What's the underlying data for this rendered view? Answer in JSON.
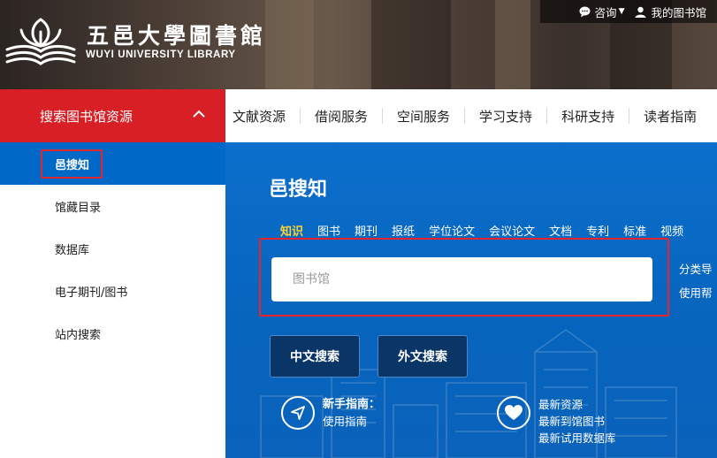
{
  "header": {
    "logo_cn": "五邑大學圖書館",
    "logo_en": "WUYI UNIVERSITY LIBRARY",
    "top_links": [
      {
        "label": "咨询",
        "icon": "chat-icon"
      },
      {
        "label": "我的图书馆",
        "icon": "user-icon"
      }
    ]
  },
  "nav": {
    "resource_label": "搜索图书馆资源",
    "items": [
      "文献资源",
      "借阅服务",
      "空间服务",
      "学习支持",
      "科研支持",
      "读者指南"
    ]
  },
  "side_menu": {
    "items": [
      "邑搜知",
      "馆藏目录",
      "数据库",
      "电子期刊/图书",
      "站内搜索"
    ],
    "active_index": 0
  },
  "search": {
    "title": "邑搜知",
    "tabs": [
      "知识",
      "图书",
      "期刊",
      "报纸",
      "学位论文",
      "会议论文",
      "文档",
      "专利",
      "标准",
      "视频"
    ],
    "active_tab": "知识",
    "placeholder": "图书馆",
    "side_links": [
      "分类导",
      "使用帮"
    ],
    "buttons": {
      "chinese": "中文搜索",
      "foreign": "外文搜索"
    }
  },
  "guide": {
    "title": "新手指南：",
    "link": "使用指南",
    "icon": "navigation-arrow-icon"
  },
  "latest": {
    "icon": "heart-icon",
    "links": [
      "最新资源",
      "最新到馆图书",
      "最新试用数据库"
    ]
  },
  "colors": {
    "brand_red": "#d71f25",
    "panel_blue": "#0a66c2",
    "active_tab_yellow": "#ffd12f",
    "button_navy": "#0a3567"
  }
}
